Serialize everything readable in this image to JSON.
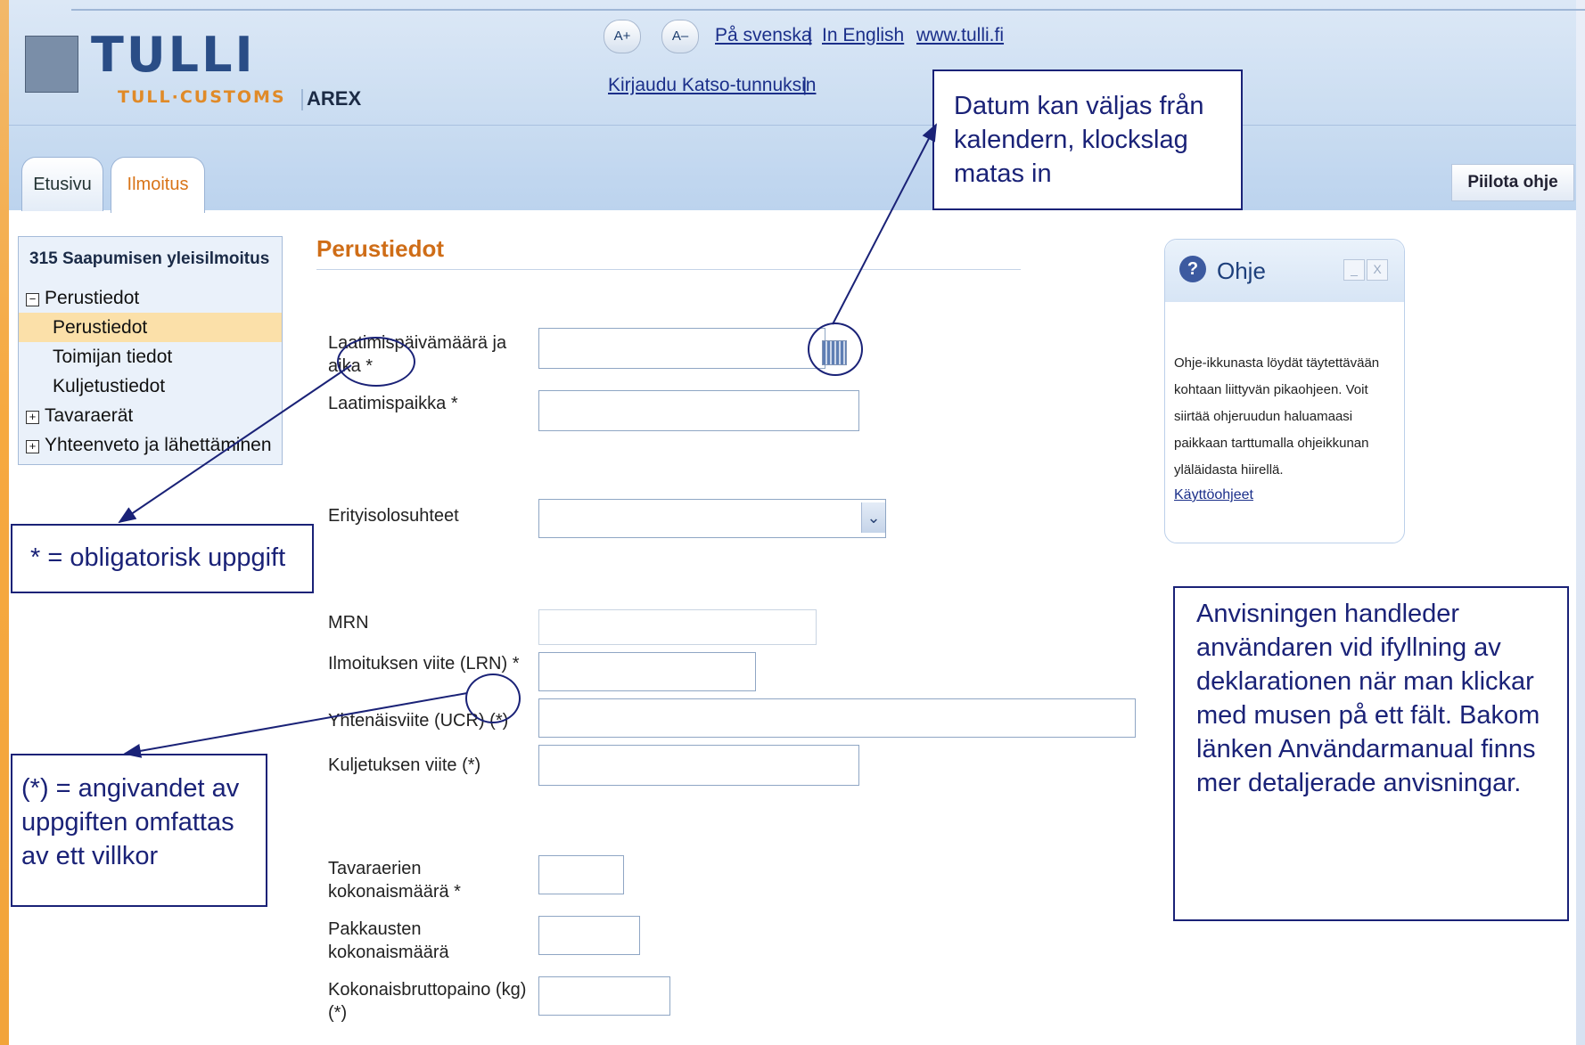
{
  "header": {
    "logo_title": "TULLI",
    "logo_sub": "TULL·CUSTOMS",
    "app_name": "AREX",
    "font_increase": "A+",
    "font_decrease": "A–",
    "lang_swedish": "På svenska",
    "lang_separator_1": "|",
    "lang_english": "In English",
    "site_link": "www.tulli.fi",
    "login_link": "Kirjaudu Katso-tunnuksin",
    "login_separator": "|",
    "hide_help": "Piilota ohje"
  },
  "tabs": [
    {
      "label": "Etusivu"
    },
    {
      "label": "Ilmoitus"
    }
  ],
  "sidebar": {
    "title": "315 Saapumisen yleisilmoitus",
    "items": [
      {
        "label": "Perustiedot",
        "toggle": "−"
      },
      {
        "label": "Perustiedot"
      },
      {
        "label": "Toimijan tiedot"
      },
      {
        "label": "Kuljetustiedot"
      },
      {
        "label": "Tavaraerät",
        "toggle": "+"
      },
      {
        "label": "Yhteenveto ja lähettäminen",
        "toggle": "+"
      }
    ]
  },
  "form": {
    "title": "Perustiedot",
    "labels": {
      "date_line1": "Laatimispäivämäärä ja",
      "date_line2": "aika *",
      "place": "Laatimispaikka *",
      "special": "Erityisolosuhteet",
      "mrn": "MRN",
      "lrn": "Ilmoituksen viite (LRN) *",
      "ucr": "Yhtenäisviite (UCR) (*)",
      "transport_ref": "Kuljetuksen viite (*)",
      "items_total_line1": "Tavaraerien",
      "items_total_line2": "kokonaismäärä *",
      "packages_line1": "Pakkausten",
      "packages_line2": "kokonaismäärä",
      "gross_line1": "Kokonaisbruttopaino (kg)",
      "gross_line2": "(*)"
    },
    "values": {
      "date": "",
      "place": "",
      "special": "",
      "mrn": "",
      "lrn": "",
      "ucr": "",
      "transport_ref": "",
      "items_total": "",
      "packages": "",
      "gross": ""
    }
  },
  "help": {
    "title": "Ohje",
    "icon": "?",
    "minimize": "_",
    "close": "X",
    "text": "Ohje-ikkunasta löydät täytettävään kohtaan liittyvän pikaohjeen. Voit siirtää ohjeruudun haluamaasi paikkaan tarttumalla ohjeikkunan yläläidasta hiirellä.",
    "link": "Käyttöohjeet"
  },
  "annotations": {
    "calendar": "Datum kan väljas från kalendern, klockslag matas in",
    "mandatory": "* = obligatorisk uppgift",
    "conditional": "(*) = angivandet av uppgiften omfattas av ett villkor",
    "guidance": "Anvisningen handleder användaren vid ifyllning av deklarationen när man klickar med musen på ett fält. Bakom länken Användarmanual finns mer detaljerade anvisningar."
  },
  "colors": {
    "accent_orange": "#cf6d17",
    "header_blue": "#c9dcf1",
    "annotation_blue": "#1a2277",
    "selected_nav": "#fbe0a9"
  }
}
